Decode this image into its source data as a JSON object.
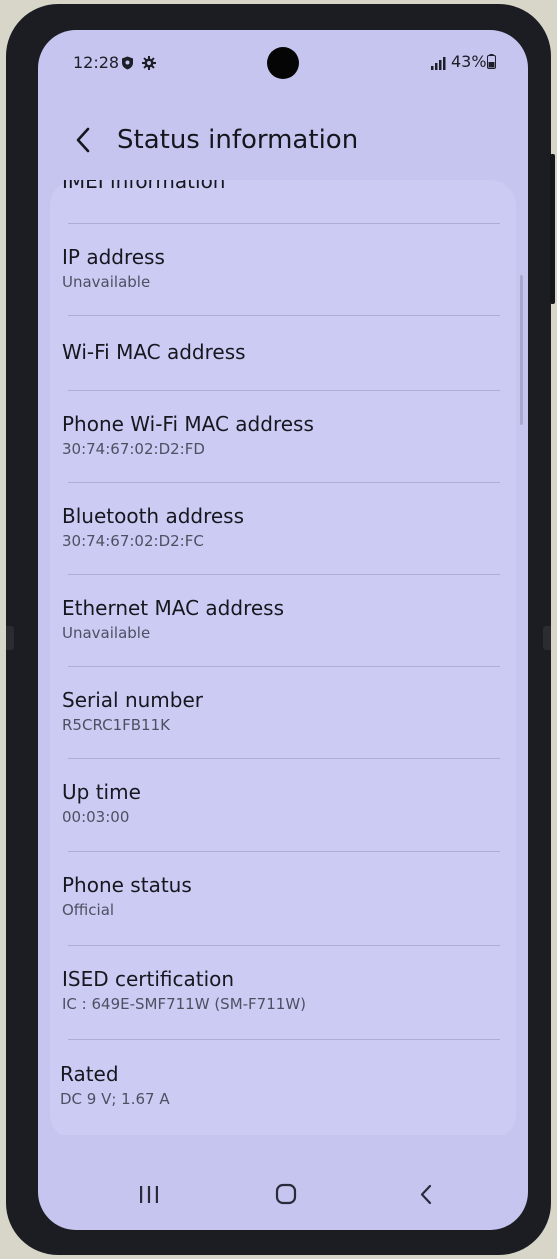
{
  "status_bar": {
    "time": "12:28",
    "battery": "43%",
    "icons": [
      "shield-icon",
      "gear-icon",
      "signal-icon",
      "battery-icon"
    ]
  },
  "header": {
    "title": "Status information",
    "back_icon": "back-arrow-icon"
  },
  "items": [
    {
      "label": "IMEI information",
      "value": ""
    },
    {
      "label": "IP address",
      "value": "Unavailable"
    },
    {
      "label": "Wi-Fi MAC address",
      "value": ""
    },
    {
      "label": "Phone Wi-Fi MAC address",
      "value": "30:74:67:02:D2:FD"
    },
    {
      "label": "Bluetooth address",
      "value": "30:74:67:02:D2:FC"
    },
    {
      "label": "Ethernet MAC address",
      "value": "Unavailable"
    },
    {
      "label": "Serial number",
      "value": "R5CRC1FB11K"
    },
    {
      "label": "Up time",
      "value": "00:03:00"
    },
    {
      "label": "Phone status",
      "value": "Official"
    },
    {
      "label": "ISED certification",
      "value": "IC : 649E-SMF711W (SM-F711W)"
    },
    {
      "label": "Rated",
      "value": "DC 9 V; 1.67 A"
    }
  ],
  "nav_bar": {
    "icons": [
      "recents-icon",
      "home-icon",
      "back-icon"
    ]
  },
  "colors": {
    "screen_bg": "#c5c5ef",
    "card_bg": "#cbcbf3",
    "text_primary": "#17171f",
    "text_secondary": "#4e5062"
  }
}
